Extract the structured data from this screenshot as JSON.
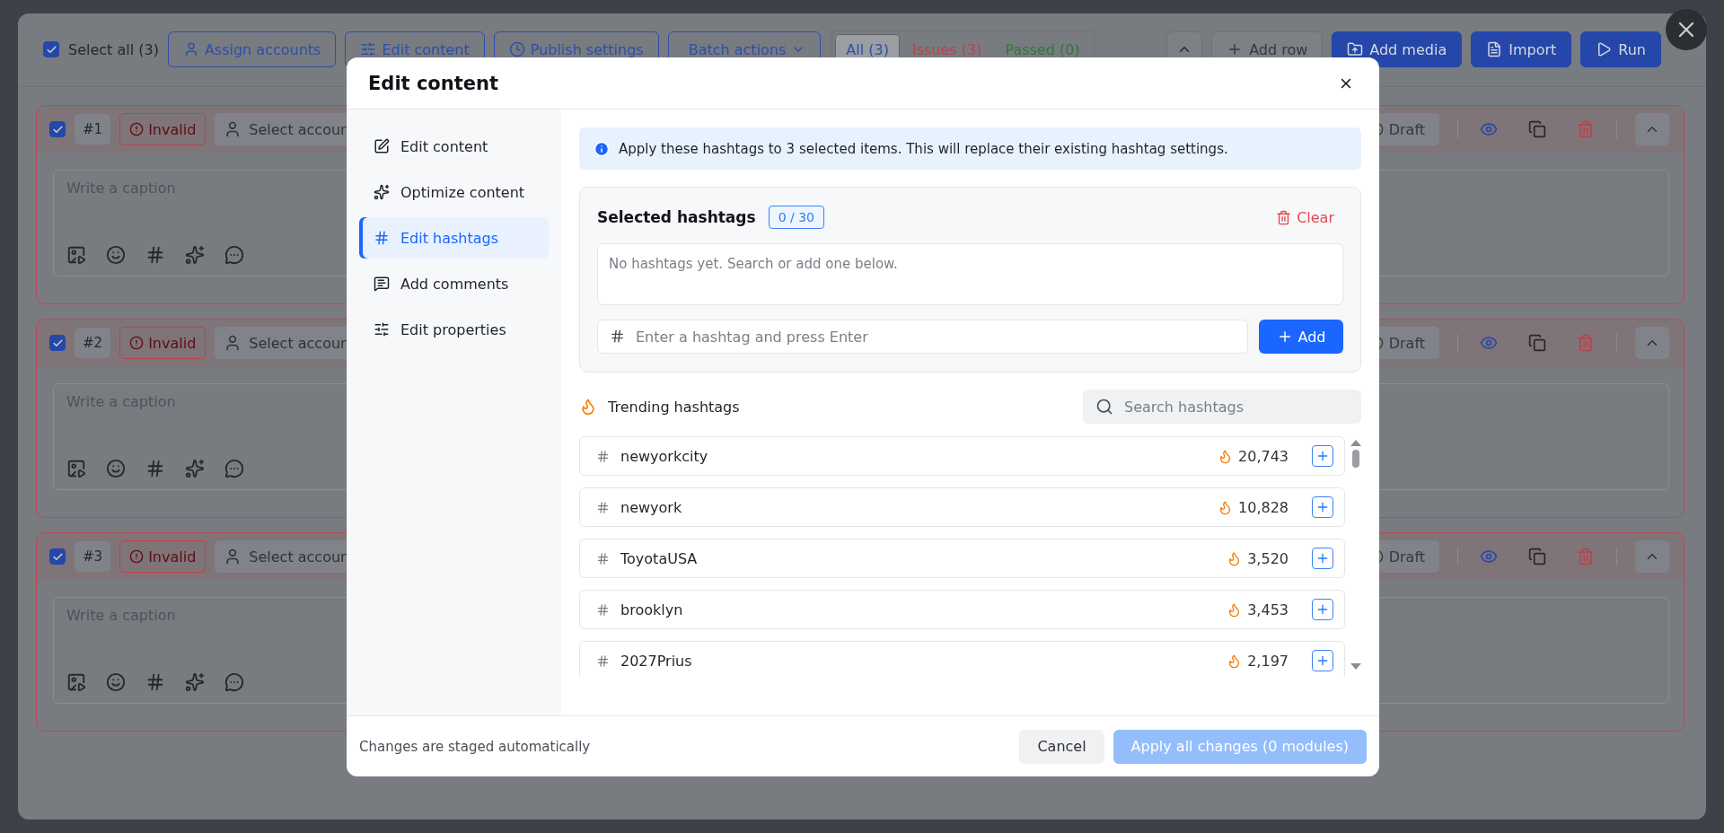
{
  "toolbar": {
    "select_all": {
      "label": "Select all (3)",
      "checked": true
    },
    "buttons": [
      "Assign accounts",
      "Edit content",
      "Publish settings",
      "Batch actions"
    ],
    "filters": [
      {
        "label": "All (3)",
        "kind": "all",
        "selected": true
      },
      {
        "label": "Issues (3)",
        "kind": "issues",
        "selected": false
      },
      {
        "label": "Passed (0)",
        "kind": "passed",
        "selected": false
      }
    ],
    "actions": [
      {
        "label": "Add row",
        "kind": "plain"
      },
      {
        "label": "Add media",
        "kind": "primary"
      },
      {
        "label": "Import",
        "kind": "primary"
      },
      {
        "label": "Run",
        "kind": "primary"
      }
    ]
  },
  "posts": [
    {
      "number": "#1",
      "checked": true,
      "status": "Invalid",
      "account": "Select accoun",
      "caption_placeholder": "Write a caption",
      "schedule": "Draft"
    },
    {
      "number": "#2",
      "checked": true,
      "status": "Invalid",
      "account": "Select accoun",
      "caption_placeholder": "Write a caption",
      "schedule": "Draft"
    },
    {
      "number": "#3",
      "checked": true,
      "status": "Invalid",
      "account": "Select accoun",
      "caption_placeholder": "Write a caption",
      "schedule": "Draft"
    }
  ],
  "modal": {
    "title": "Edit content",
    "nav": [
      {
        "label": "Edit content",
        "selected": false
      },
      {
        "label": "Optimize content",
        "selected": false
      },
      {
        "label": "Edit hashtags",
        "selected": true
      },
      {
        "label": "Add comments",
        "selected": false
      },
      {
        "label": "Edit properties",
        "selected": false
      }
    ],
    "notice": "Apply these hashtags to 3 selected items. This will replace their existing hashtag settings.",
    "selected_hashtags": {
      "title": "Selected hashtags",
      "count": "0 / 30",
      "clear": "Clear",
      "empty_text": "No hashtags yet. Search or add one below.",
      "input_placeholder": "Enter a hashtag and press Enter",
      "add": "Add"
    },
    "trending": {
      "title": "Trending hashtags",
      "search_placeholder": "Search hashtags",
      "items": [
        {
          "tag": "newyorkcity",
          "count": "20,743"
        },
        {
          "tag": "newyork",
          "count": "10,828"
        },
        {
          "tag": "ToyotaUSA",
          "count": "3,520"
        },
        {
          "tag": "brooklyn",
          "count": "3,453"
        },
        {
          "tag": "2027Prius",
          "count": "2,197"
        }
      ]
    },
    "footer": {
      "note": "Changes are staged automatically",
      "cancel": "Cancel",
      "apply": {
        "label": "Apply all changes (0 modules)",
        "disabled": true
      }
    }
  }
}
